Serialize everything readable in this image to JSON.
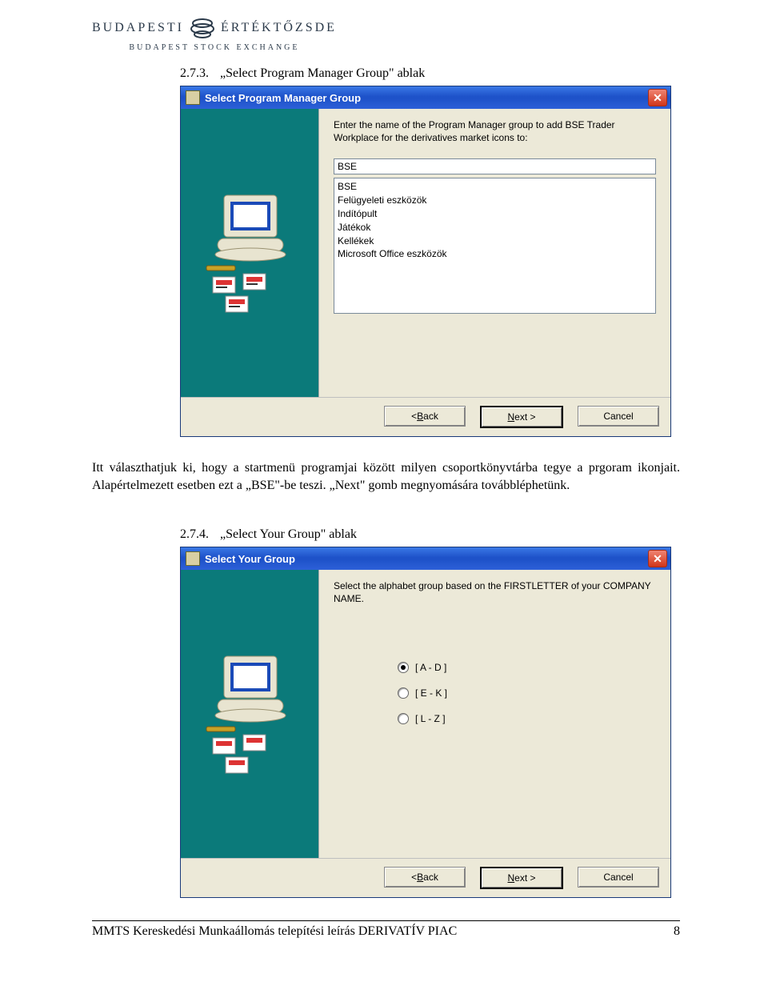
{
  "header": {
    "brand_left": "BUDAPESTI",
    "brand_right": "ÉRTÉKTŐZSDE",
    "brand_sub": "BUDAPEST STOCK EXCHANGE"
  },
  "section1": {
    "number": "2.7.3.",
    "title": "„Select Program Manager Group\" ablak"
  },
  "dialog1": {
    "title": "Select Program Manager Group",
    "instruction": "Enter the name of the Program Manager group to add BSE Trader Workplace for the derivatives market icons to:",
    "input_value": "BSE",
    "list_items": [
      "BSE",
      "Felügyeleti eszközök",
      "Indítópult",
      "Játékok",
      "Kellékek",
      "Microsoft Office eszközök"
    ],
    "back_prefix": "< ",
    "back_u": "B",
    "back_rest": "ack",
    "next_u": "N",
    "next_rest": "ext >",
    "cancel": "Cancel"
  },
  "paragraph1": "Itt választhatjuk ki, hogy a startmenü programjai között milyen csoportkönyvtárba tegye a prgoram ikonjait. Alapértelmezett esetben ezt a „BSE\"-be teszi. „Next\" gomb megnyomására továbbléphetünk.",
  "section2": {
    "number": "2.7.4.",
    "title": "„Select Your Group\" ablak"
  },
  "dialog2": {
    "title": "Select Your Group",
    "instruction": "Select the alphabet group based on the FIRSTLETTER of your COMPANY NAME.",
    "options": [
      {
        "label": "[ A  -  D ]",
        "checked": true
      },
      {
        "label": "[ E  -  K ]",
        "checked": false
      },
      {
        "label": "[ L  -  Z ]",
        "checked": false
      }
    ],
    "back_prefix": "< ",
    "back_u": "B",
    "back_rest": "ack",
    "next_u": "N",
    "next_rest": "ext >",
    "cancel": "Cancel"
  },
  "footer": {
    "text": "MMTS Kereskedési Munkaállomás telepítési leírás DERIVATÍV PIAC",
    "page": "8"
  }
}
